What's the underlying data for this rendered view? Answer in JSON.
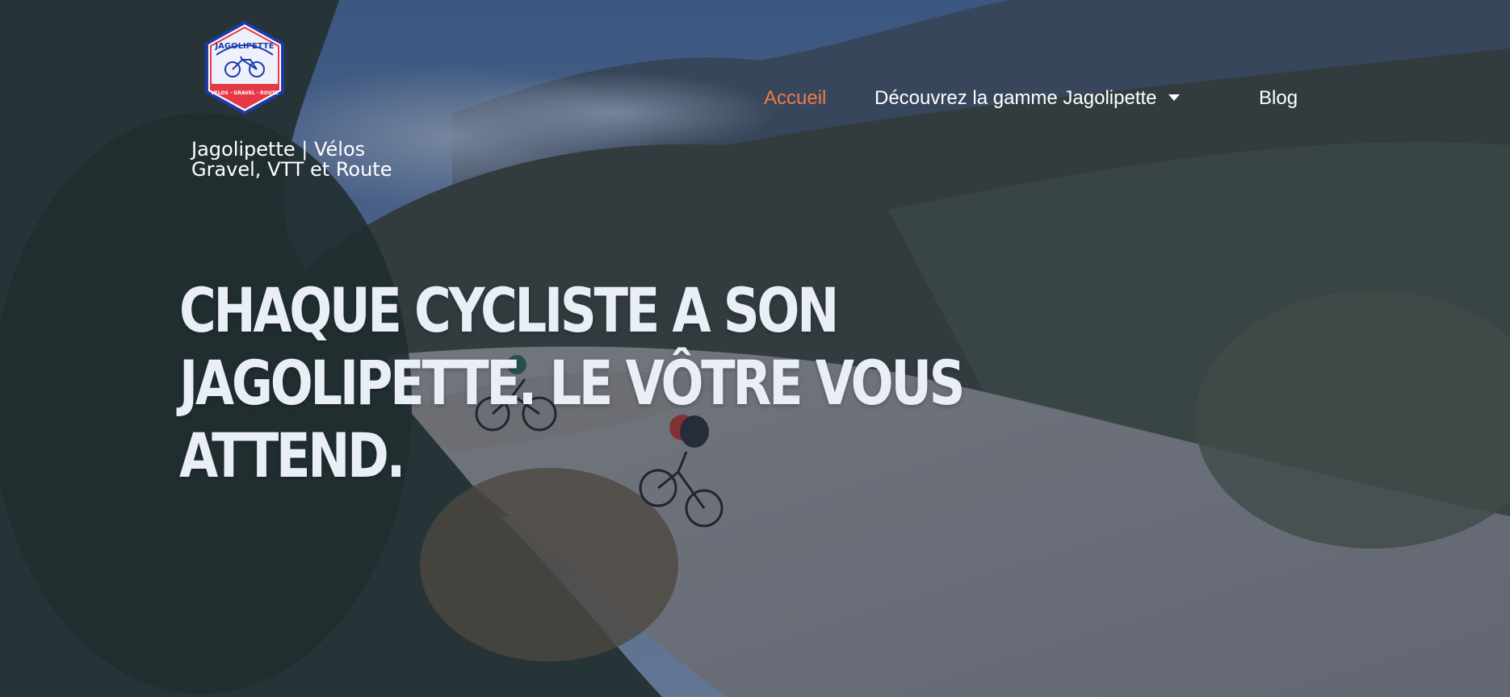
{
  "brand": {
    "logo_text": "JAGOLIPETTE",
    "logo_ribbon": "VELOS · GRAVEL · ROUTE",
    "site_title": "Jagolipette | Vélos Gravel, VTT et Route"
  },
  "nav": {
    "items": [
      {
        "label": "Accueil",
        "active": true
      },
      {
        "label": "Découvrez la gamme Jagolipette",
        "has_dropdown": true
      },
      {
        "label": "Blog"
      }
    ]
  },
  "hero": {
    "headline": "Chaque cycliste a son Jagolipette. Le vôtre vous attend."
  },
  "colors": {
    "accent": "#f07b4a",
    "text": "#ffffff",
    "headline": "#e9eef7",
    "logo_red": "#e63946",
    "logo_blue": "#1d3aa8"
  }
}
